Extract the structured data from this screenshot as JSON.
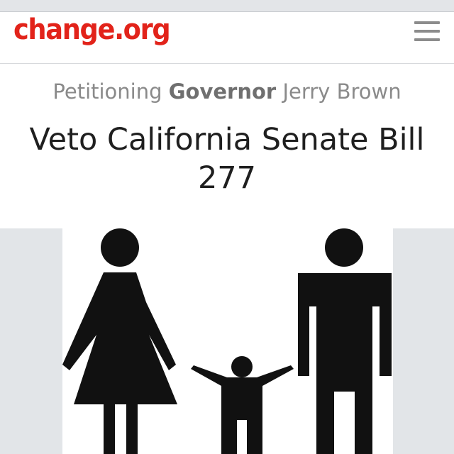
{
  "header": {
    "logo_text": "change.org",
    "menu_icon": "hamburger-menu-icon"
  },
  "petition": {
    "prefix": "Petitioning",
    "target_title": "Governor",
    "target_name": "Jerry Brown",
    "title": "Veto California Senate Bill 277"
  },
  "image": {
    "subject": "family-figures-icon",
    "fill_color": "#111111"
  },
  "colors": {
    "brand": "#e2231a",
    "menu_icon": "#8c8c8c",
    "muted_text": "#8a8a8a",
    "title_text": "#1f1f1f",
    "side_panel": "#e2e5e8"
  }
}
